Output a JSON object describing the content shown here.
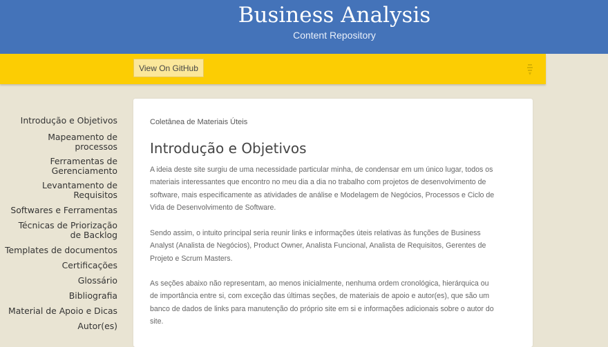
{
  "header": {
    "title": "Business Analysis",
    "subtitle": "Content Repository",
    "bg_color": "#4473b9"
  },
  "ribbon": {
    "github_label": "View On GitHub",
    "icon": "download-icon",
    "bg_color": "#fccd03"
  },
  "sidebar": {
    "items": [
      {
        "label": "Introdução e Objetivos"
      },
      {
        "label": "Mapeamento de processos"
      },
      {
        "label": "Ferramentas de Gerenciamento"
      },
      {
        "label": "Levantamento de Requisitos"
      },
      {
        "label": "Softwares e Ferramentas"
      },
      {
        "label": "Técnicas de Priorização de Backlog"
      },
      {
        "label": "Templates de documentos"
      },
      {
        "label": "Certificações"
      },
      {
        "label": "Glossário"
      },
      {
        "label": "Bibliografia"
      },
      {
        "label": "Material de Apoio e Dicas"
      },
      {
        "label": "Autor(es)"
      }
    ]
  },
  "main": {
    "breadcrumb": "Coletânea de Materiais Úteis",
    "title": "Introdução e Objetivos",
    "paragraphs": [
      "A ideia deste site surgiu de uma necessidade particular minha, de condensar em um único lugar, todos os materiais interessantes que encontro no meu dia a dia no trabalho com projetos de desenvolvimento de software, mais especificamente as atividades de análise e Modelagem de Negócios, Processos e Ciclo de Vida de Desenvolvimento de Software.",
      "Sendo assim, o intuito principal seria reunir links e informações úteis relativas às funções de Business Analyst (Analista de Negócios), Product Owner, Analista Funcional, Analista de Requisitos, Gerentes de Projeto e Scrum Masters.",
      "As seções abaixo não representam, ao menos inicialmente, nenhuma ordem cronológica, hierárquica ou de importância entre si, com exceção das últimas seções, de materiais de apoio e autor(es), que são um banco de dados de links para manutenção do próprio site em si e informações adicionais sobre o autor do site."
    ]
  }
}
